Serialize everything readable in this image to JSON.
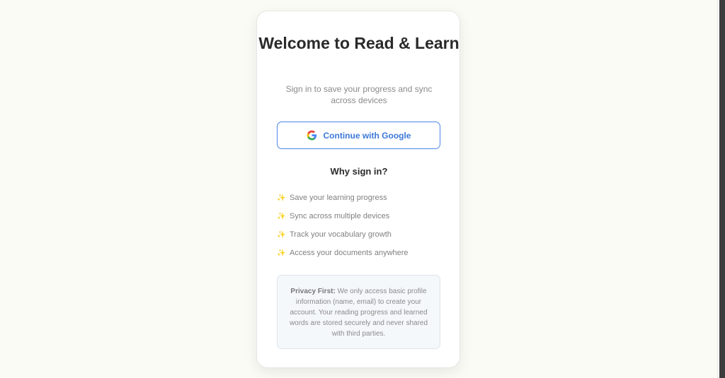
{
  "card": {
    "title": "Welcome to Read & Learn",
    "subtitle": "Sign in to save your progress and sync across devices"
  },
  "google_button": {
    "label": "Continue with Google",
    "icon": "google-g-icon",
    "accent_color": "#4a86e8"
  },
  "benefits": {
    "heading": "Why sign in?",
    "icon": "sparkle-icon",
    "items": [
      "Save your learning progress",
      "Sync across multiple devices",
      "Track your vocabulary growth",
      "Access your documents anywhere"
    ]
  },
  "privacy": {
    "label": "Privacy First:",
    "text": " We only access basic profile information (name, email) to create your account. Your reading progress and learned words are stored securely and never shared with third parties."
  },
  "colors": {
    "page_background": "#fbfbf5",
    "card_background": "#ffffff",
    "privacy_background": "#f5f8fb"
  }
}
